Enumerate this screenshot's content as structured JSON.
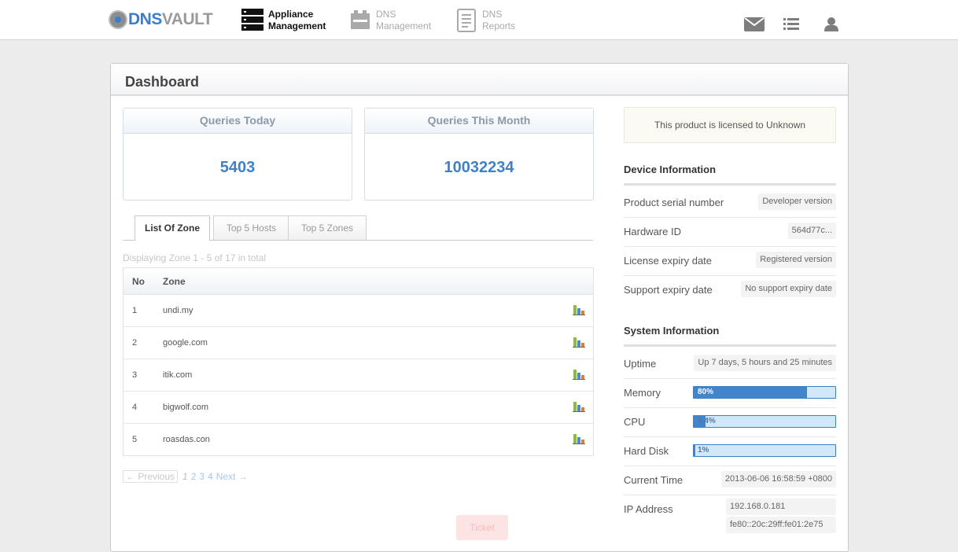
{
  "brand": {
    "dns": "DNS",
    "vault": "VAULT"
  },
  "nav": [
    {
      "line1": "Appliance",
      "line2": "Management",
      "active": true
    },
    {
      "line1": "DNS",
      "line2": "Management",
      "active": false
    },
    {
      "line1": "DNS",
      "line2": "Reports",
      "active": false
    }
  ],
  "topIcons": [
    "mail-icon",
    "list-icon",
    "user-icon"
  ],
  "panel": {
    "title": "Dashboard"
  },
  "stats": {
    "today": {
      "label": "Queries Today",
      "value": "5403"
    },
    "month": {
      "label": "Queries This Month",
      "value": "10032234"
    }
  },
  "tabs": [
    {
      "label": "List Of Zone",
      "active": true
    },
    {
      "label": "Top 5 Hosts",
      "active": false
    },
    {
      "label": "Top 5 Zones",
      "active": false
    }
  ],
  "displaying": "Displaying Zone 1 - 5 of 17 in total",
  "table": {
    "headers": {
      "no": "No",
      "zone": "Zone"
    },
    "rows": [
      {
        "no": "1",
        "zone": "undi.my"
      },
      {
        "no": "2",
        "zone": "google.com"
      },
      {
        "no": "3",
        "zone": "itik.com"
      },
      {
        "no": "4",
        "zone": "bigwolf.com"
      },
      {
        "no": "5",
        "zone": "roasdas.con"
      }
    ]
  },
  "pager": {
    "prev": "← Previous",
    "pages": [
      "1",
      "2",
      "3",
      "4"
    ],
    "next": "Next →"
  },
  "ticket": "Ticket",
  "license": "This product is licensed to Unknown",
  "device": {
    "title": "Device Information",
    "rows": [
      {
        "label": "Product serial number",
        "value": "Developer version"
      },
      {
        "label": "Hardware ID",
        "value": "564d77c..."
      },
      {
        "label": "License expiry date",
        "value": "Registered version"
      },
      {
        "label": "Support expiry date",
        "value": "No support expiry date"
      }
    ]
  },
  "system": {
    "title": "System Information",
    "uptime": {
      "label": "Uptime",
      "value": "Up 7 days, 5 hours and 25 minutes"
    },
    "memory": {
      "label": "Memory",
      "text": "80%",
      "fraction": 0.8
    },
    "cpu": {
      "label": "CPU",
      "text": "8.4%",
      "fraction": 0.084
    },
    "disk": {
      "label": "Hard Disk",
      "text": "1%",
      "fraction": 0.01
    },
    "time": {
      "label": "Current Time",
      "value": "2013-06-06 16:58:59 +0800"
    },
    "ip": {
      "label": "IP Address",
      "v4": "192.168.0.181",
      "v6": "fe80::20c:29ff:fe01:2e75"
    }
  },
  "colors": {
    "accent": "#3d82c8",
    "bar": "#4186cd",
    "barBg": "#d2e7f8"
  }
}
